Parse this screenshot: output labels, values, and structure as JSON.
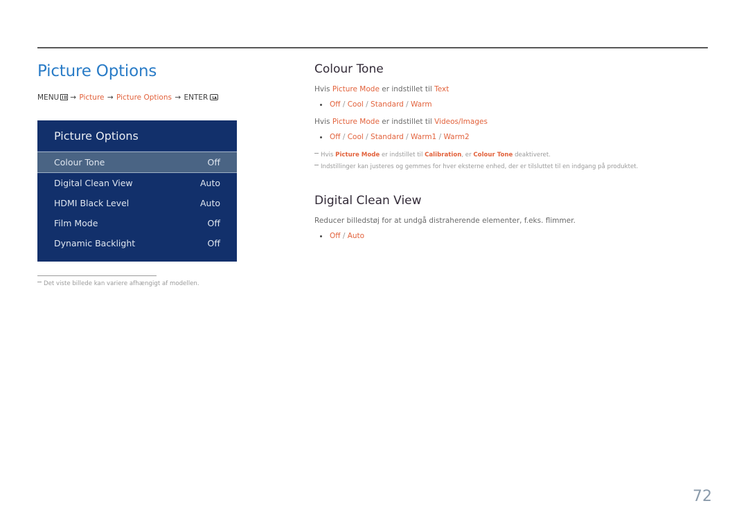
{
  "page": {
    "number": "72"
  },
  "left": {
    "title": "Picture Options",
    "breadcrumb": {
      "menu_label": "MENU",
      "menu_icon": "menu-grid-icon",
      "arrow": "→",
      "crumb1": "Picture",
      "crumb2": "Picture Options",
      "enter_label": "ENTER",
      "enter_icon": "enter-return-icon"
    },
    "osd": {
      "header": "Picture Options",
      "rows": [
        {
          "label": "Colour Tone",
          "value": "Off",
          "selected": true
        },
        {
          "label": "Digital Clean View",
          "value": "Auto",
          "selected": false
        },
        {
          "label": "HDMI Black Level",
          "value": "Auto",
          "selected": false
        },
        {
          "label": "Film Mode",
          "value": "Off",
          "selected": false
        },
        {
          "label": "Dynamic Backlight",
          "value": "Off",
          "selected": false
        }
      ]
    },
    "footnote": "Det viste billede kan variere afhængigt af modellen."
  },
  "right": {
    "section1": {
      "title": "Colour Tone",
      "line1_pre": "Hvis ",
      "line1_hl1": "Picture Mode",
      "line1_mid": " er indstillet til ",
      "line1_hl2": "Text",
      "bullet1": "Off / Cool / Standard / Warm",
      "line2_pre": "Hvis ",
      "line2_hl1": "Picture Mode",
      "line2_mid": " er indstillet til ",
      "line2_hl2": "Videos/Images",
      "bullet2": "Off / Cool / Standard / Warm1 / Warm2",
      "note1_pre": "Hvis ",
      "note1_hl1": "Picture Mode",
      "note1_mid": " er indstillet til ",
      "note1_hl2": "Calibration",
      "note1_mid2": ", er ",
      "note1_hl3": "Colour Tone",
      "note1_end": " deaktiveret.",
      "note2": "Indstillinger kan justeres og gemmes for hver eksterne enhed, der er tilsluttet til en indgang på produktet."
    },
    "section2": {
      "title": "Digital Clean View",
      "description": "Reducer billedstøj for at undgå distraherende elementer, f.eks. flimmer.",
      "bullet1": "Off / Auto"
    }
  },
  "colors": {
    "title_blue": "#2a7cc7",
    "accent_orange": "#e2623c",
    "osd_navy": "#12306b",
    "osd_selected": "#4a6484",
    "heading_dark": "#332b38",
    "page_number": "#8b9bab"
  }
}
